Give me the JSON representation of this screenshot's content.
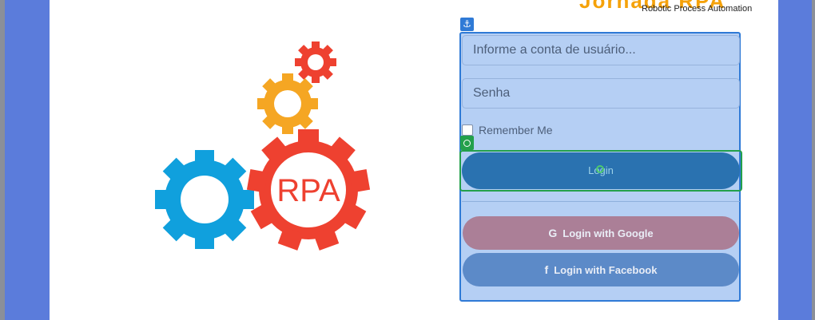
{
  "brand": {
    "title": "Jornada RPA",
    "subtitle": "Robotic Process Automation",
    "logo_text": "RPA"
  },
  "form": {
    "username_placeholder": "Informe a conta de usuário...",
    "password_placeholder": "Senha",
    "remember_label": "Remember Me",
    "login_label": "Login",
    "google_label": "Login with Google",
    "facebook_label": "Login with Facebook"
  },
  "icons": {
    "anchor": "anchor-icon",
    "target": "target-icon",
    "google": "google-icon",
    "facebook": "facebook-icon"
  },
  "colors": {
    "selection_fill": "#b5cff4",
    "selection_border": "#2f7ad6",
    "target_highlight": "#23a04b",
    "login_button": "#2a72b0",
    "google_button": "#ab7f97",
    "facebook_button": "#5c8ac8",
    "gear_red": "#ee4130",
    "gear_orange": "#f5a623",
    "gear_blue": "#10a0dd"
  }
}
